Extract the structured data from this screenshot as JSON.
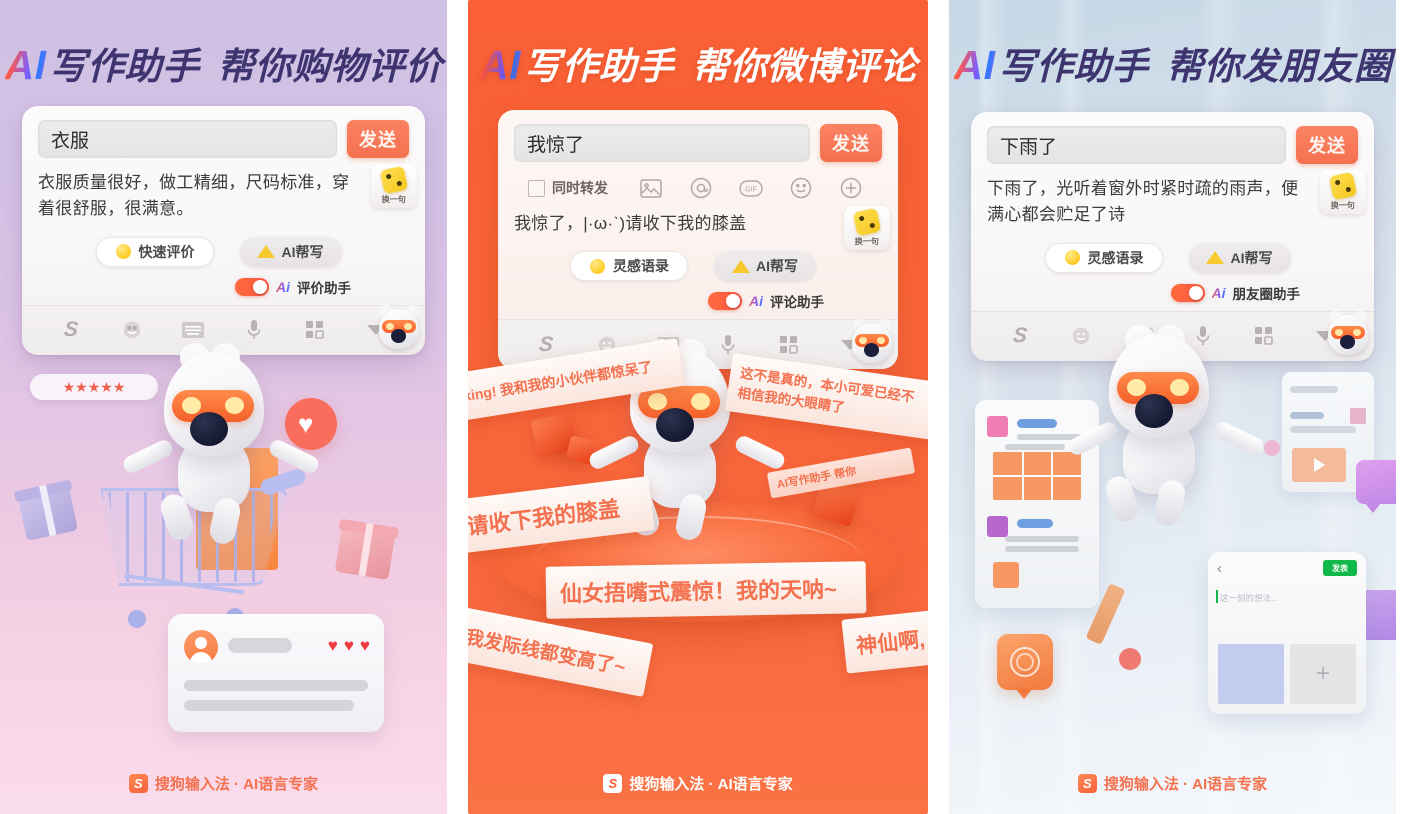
{
  "brand": {
    "mark": "S",
    "text": "搜狗输入法 · AI语言专家"
  },
  "panels": [
    {
      "id": "shopping",
      "headline": {
        "ai": "AI",
        "rest": "写作助手",
        "tail": "帮你购物评价"
      },
      "keyboard": {
        "input_value": "衣服",
        "send_label": "发送",
        "suggestion": "衣服质量很好，做工精细，尺码标准，穿着很舒服，很满意。",
        "refresh_label": "换一句",
        "pills": [
          {
            "label": "快速评价",
            "icon": "lamp-icon",
            "style": "hollow"
          },
          {
            "label": "AI帮写",
            "icon": "pencil-icon",
            "style": "solid"
          }
        ],
        "toggle": {
          "ai": "Ai",
          "label": "评价助手",
          "on": true
        },
        "bar_icons": [
          "sogou-logo-icon",
          "emoji-icon",
          "keyboard-icon",
          "microphone-icon",
          "grid-icon",
          "collapse-icon"
        ]
      },
      "illustration": {
        "stars": "★★★★★",
        "heart": "♥",
        "review_hearts": [
          "♥",
          "♥",
          "♥"
        ]
      }
    },
    {
      "id": "weibo",
      "headline": {
        "ai": "AI",
        "rest": "写作助手",
        "tail": "帮你微博评论"
      },
      "keyboard": {
        "input_value": "我惊了",
        "send_label": "发送",
        "repost_label": "同时转发",
        "weibo_icons": [
          "image-icon",
          "at-icon",
          "gif-icon",
          "emoji-icon",
          "plus-icon"
        ],
        "suggestion": "我惊了，|·ω·ˋ)请收下我的膝盖",
        "refresh_label": "换一句",
        "pills": [
          {
            "label": "灵感语录",
            "icon": "lamp-icon",
            "style": "hollow"
          },
          {
            "label": "AI帮写",
            "icon": "pencil-icon",
            "style": "solid"
          }
        ],
        "toggle": {
          "ai": "Ai",
          "label": "评论助手",
          "on": true
        },
        "bar_icons": [
          "sogou-logo-icon",
          "emoji-icon",
          "keyboard-icon",
          "microphone-icon",
          "grid-icon",
          "collapse-icon"
        ]
      },
      "illustration": {
        "ribbons": [
          "king! 我和我的小伙伴都惊呆了",
          "这不是真的，本小可爱已经不",
          "相信我的大眼睛了",
          "请收下我的膝盖",
          "仙女捂嘴式震惊！我的天呐~",
          "我发际线都变高了~",
          "神仙啊,",
          "AI写作助手 帮你"
        ]
      }
    },
    {
      "id": "moments",
      "headline": {
        "ai": "AI",
        "rest": "写作助手",
        "tail": "帮你发朋友圈"
      },
      "keyboard": {
        "input_value": "下雨了",
        "send_label": "发送",
        "suggestion": "下雨了，光听着窗外时紧时疏的雨声，便满心都会贮足了诗",
        "refresh_label": "换一句",
        "pills": [
          {
            "label": "灵感语录",
            "icon": "lamp-icon",
            "style": "hollow"
          },
          {
            "label": "AI帮写",
            "icon": "pencil-icon",
            "style": "solid"
          }
        ],
        "toggle": {
          "ai": "Ai",
          "label": "朋友圈助手",
          "on": true
        },
        "bar_icons": [
          "sogou-logo-icon",
          "emoji-icon",
          "keyboard-icon",
          "microphone-icon",
          "grid-icon",
          "collapse-icon"
        ]
      },
      "illustration": {
        "moment_back": "‹",
        "moment_publish": "发表",
        "moment_placeholder": "这一刻的想法...",
        "moment_add": "+"
      }
    }
  ],
  "colors": {
    "accent_orange": "#f4714f",
    "headline_purple": "#3d3470",
    "panel2_bg": "#f96236",
    "toggle_on": "#ff6a3d",
    "wechat_green": "#12b84a"
  }
}
